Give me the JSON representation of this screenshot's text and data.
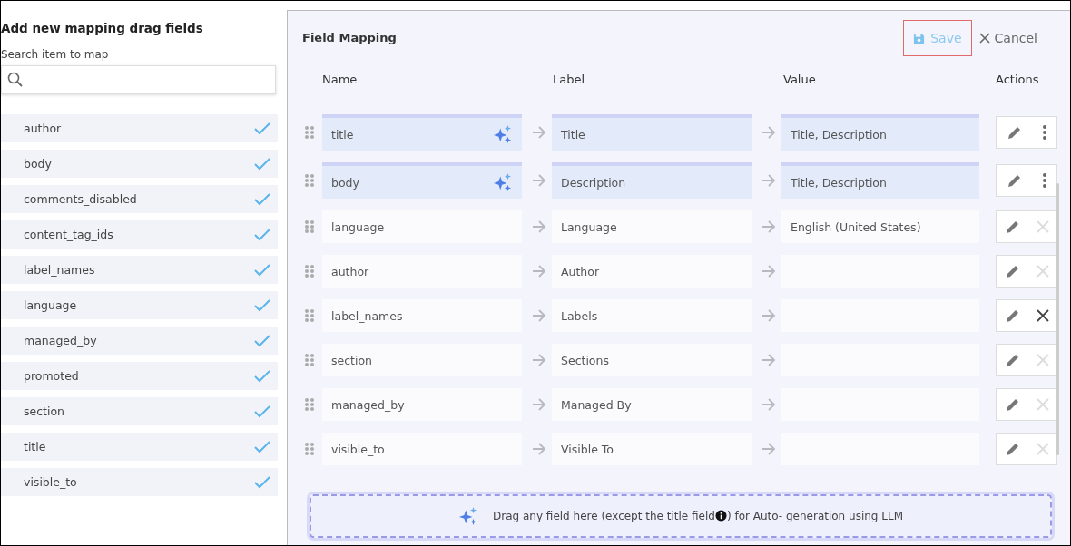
{
  "picker": {
    "title": "Add new mapping drag fields",
    "search_label": "Search item to map",
    "items": [
      {
        "name": "author",
        "checked": true
      },
      {
        "name": "body",
        "checked": true
      },
      {
        "name": "comments_disabled",
        "checked": true
      },
      {
        "name": "content_tag_ids",
        "checked": true
      },
      {
        "name": "label_names",
        "checked": true
      },
      {
        "name": "language",
        "checked": true
      },
      {
        "name": "managed_by",
        "checked": true
      },
      {
        "name": "promoted",
        "checked": true
      },
      {
        "name": "section",
        "checked": true
      },
      {
        "name": "title",
        "checked": true
      },
      {
        "name": "visible_to",
        "checked": true
      }
    ]
  },
  "mapping": {
    "title": "Field Mapping",
    "save": "Save",
    "cancel": "Cancel",
    "columns": [
      "Name",
      "Label",
      "Value",
      "Actions"
    ],
    "rows": [
      {
        "name": "title",
        "label": "Title",
        "value": "Title, Description",
        "kind": "ai"
      },
      {
        "name": "body",
        "label": "Description",
        "value": "Title, Description",
        "kind": "ai"
      },
      {
        "name": "language",
        "label": "Language",
        "value": "English (United States)",
        "kind": "plain",
        "delete_enabled": false
      },
      {
        "name": "author",
        "label": "Author",
        "kind": "plain",
        "delete_enabled": false
      },
      {
        "name": "label_names",
        "label": "Labels",
        "kind": "plain",
        "delete_enabled": true
      },
      {
        "name": "section",
        "label": "Sections",
        "kind": "plain",
        "delete_enabled": false
      },
      {
        "name": "managed_by",
        "label": "Managed By",
        "kind": "plain",
        "delete_enabled": false
      },
      {
        "name": "visible_to",
        "label": "Visible To",
        "kind": "plain",
        "delete_enabled": false
      }
    ],
    "dropzone": {
      "before": "Drag any field here (except the title field",
      "after": ") for Auto- generation using LLM"
    }
  }
}
